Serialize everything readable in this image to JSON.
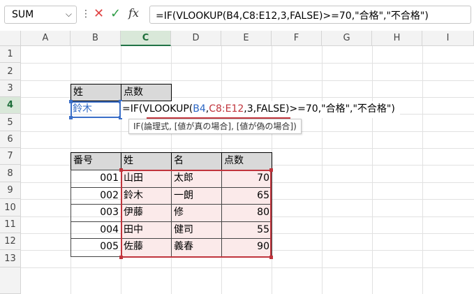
{
  "formula_bar": {
    "name_box": "SUM",
    "cancel_symbol": "✕",
    "enter_symbol": "✓",
    "fx_symbol": "fx",
    "formula": "=IF(VLOOKUP(B4,C8:E12,3,FALSE)>=70,\"合格\",\"不合格\")"
  },
  "columns": [
    "A",
    "B",
    "C",
    "D",
    "E",
    "F",
    "G",
    "H",
    "I"
  ],
  "rows": [
    "1",
    "2",
    "3",
    "4",
    "5",
    "6",
    "7",
    "8",
    "9",
    "10",
    "11",
    "12",
    "13"
  ],
  "input_table": {
    "header_name": "姓",
    "header_score": "点数",
    "name_value": "鈴木",
    "formula_prefix": "=IF(",
    "formula_func": "VLOOKUP(",
    "formula_ref1": "B4",
    "formula_comma1": ",",
    "formula_ref2": "C8:E12",
    "formula_args": ",3,FALSE)",
    "formula_suffix": ">=70,\"合格\",\"不合格\")"
  },
  "tooltip": "IF(論理式, [値が真の場合], [値が偽の場合])",
  "data_table": {
    "headers": [
      "番号",
      "姓",
      "名",
      "点数"
    ],
    "rows": [
      [
        "001",
        "山田",
        "太郎",
        "70"
      ],
      [
        "002",
        "鈴木",
        "一朗",
        "65"
      ],
      [
        "003",
        "伊藤",
        "修",
        "80"
      ],
      [
        "004",
        "田中",
        "健司",
        "55"
      ],
      [
        "005",
        "佐藤",
        "義春",
        "90"
      ]
    ]
  },
  "colors": {
    "accent_green": "#217346",
    "ref_blue": "#2b66c4",
    "ref_red": "#c0343c"
  }
}
